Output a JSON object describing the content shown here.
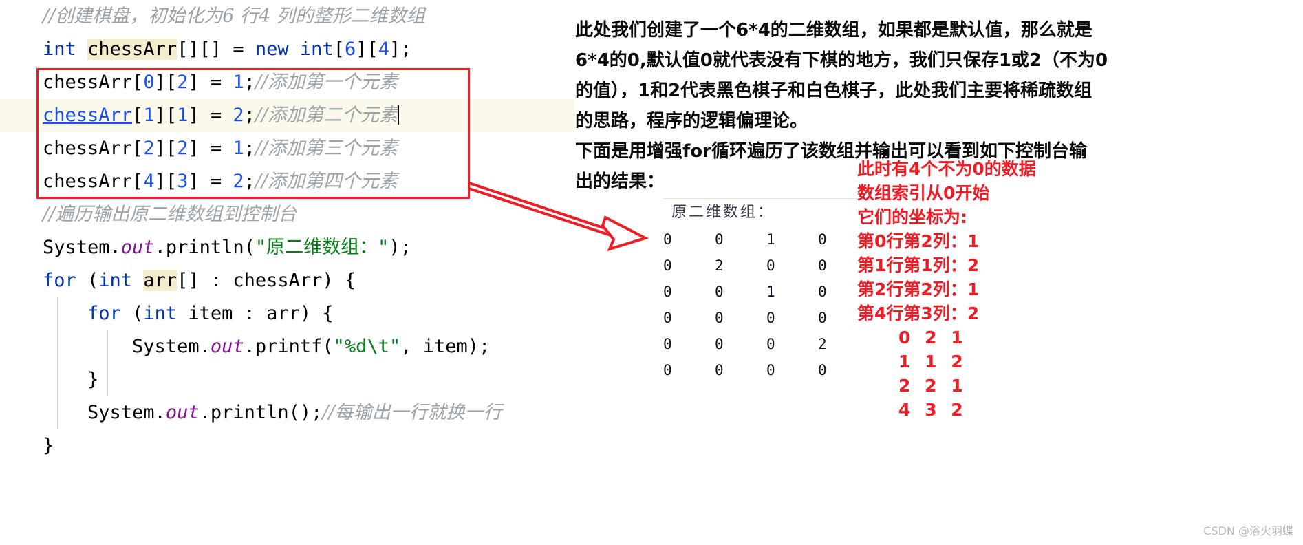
{
  "code": {
    "lines": [
      {
        "id": "c0",
        "highlight": false,
        "parts": [
          {
            "t": "//创建棋盘，初始化为6 行4 列的整形二维数组",
            "c": "cmt"
          }
        ]
      },
      {
        "id": "c1",
        "highlight": false,
        "parts": [
          {
            "t": "int ",
            "c": "kw"
          },
          {
            "t": "chessArr",
            "c": "ident-hi"
          },
          {
            "t": "[][] = ",
            "c": ""
          },
          {
            "t": "new ",
            "c": "kw"
          },
          {
            "t": "int",
            "c": "kw"
          },
          {
            "t": "[",
            "c": ""
          },
          {
            "t": "6",
            "c": "num"
          },
          {
            "t": "][",
            "c": ""
          },
          {
            "t": "4",
            "c": "num"
          },
          {
            "t": "];",
            "c": ""
          }
        ]
      },
      {
        "id": "c2",
        "highlight": false,
        "parts": [
          {
            "t": "chessArr",
            "c": ""
          },
          {
            "t": "[",
            "c": ""
          },
          {
            "t": "0",
            "c": "num"
          },
          {
            "t": "][",
            "c": ""
          },
          {
            "t": "2",
            "c": "num"
          },
          {
            "t": "] = ",
            "c": ""
          },
          {
            "t": "1",
            "c": "num"
          },
          {
            "t": ";",
            "c": ""
          },
          {
            "t": "//添加第一个元素",
            "c": "cmt"
          }
        ]
      },
      {
        "id": "c3",
        "highlight": true,
        "parts": [
          {
            "t": "chessArr",
            "c": "ident-underline"
          },
          {
            "t": "[",
            "c": ""
          },
          {
            "t": "1",
            "c": "num"
          },
          {
            "t": "][",
            "c": ""
          },
          {
            "t": "1",
            "c": "num"
          },
          {
            "t": "] = ",
            "c": ""
          },
          {
            "t": "2",
            "c": "num"
          },
          {
            "t": ";",
            "c": ""
          },
          {
            "t": "//添加第二个元素",
            "c": "cmt"
          },
          {
            "t": "CARET",
            "c": "caret"
          }
        ]
      },
      {
        "id": "c4",
        "highlight": false,
        "parts": [
          {
            "t": "chessArr",
            "c": ""
          },
          {
            "t": "[",
            "c": ""
          },
          {
            "t": "2",
            "c": "num"
          },
          {
            "t": "][",
            "c": ""
          },
          {
            "t": "2",
            "c": "num"
          },
          {
            "t": "] = ",
            "c": ""
          },
          {
            "t": "1",
            "c": "num"
          },
          {
            "t": ";",
            "c": ""
          },
          {
            "t": "//添加第三个元素",
            "c": "cmt"
          }
        ]
      },
      {
        "id": "c5",
        "highlight": false,
        "parts": [
          {
            "t": "chessArr",
            "c": ""
          },
          {
            "t": "[",
            "c": ""
          },
          {
            "t": "4",
            "c": "num"
          },
          {
            "t": "][",
            "c": ""
          },
          {
            "t": "3",
            "c": "num"
          },
          {
            "t": "] = ",
            "c": ""
          },
          {
            "t": "2",
            "c": "num"
          },
          {
            "t": ";",
            "c": ""
          },
          {
            "t": "//添加第四个元素",
            "c": "cmt"
          }
        ]
      },
      {
        "id": "c6",
        "highlight": false,
        "parts": [
          {
            "t": "//遍历输出原二维数组到控制台",
            "c": "cmt"
          }
        ]
      },
      {
        "id": "c7",
        "highlight": false,
        "parts": [
          {
            "t": "System.",
            "c": ""
          },
          {
            "t": "out",
            "c": "field"
          },
          {
            "t": ".println(",
            "c": ""
          },
          {
            "t": "\"原二维数组：\"",
            "c": "str"
          },
          {
            "t": ");",
            "c": ""
          }
        ]
      },
      {
        "id": "c8",
        "highlight": false,
        "parts": [
          {
            "t": "for ",
            "c": "kw"
          },
          {
            "t": "(",
            "c": ""
          },
          {
            "t": "int ",
            "c": "kw"
          },
          {
            "t": "arr",
            "c": "ident-hi"
          },
          {
            "t": "[] : chessArr) {",
            "c": ""
          }
        ]
      },
      {
        "id": "c9",
        "highlight": false,
        "parts": [
          {
            "t": "    ",
            "c": ""
          },
          {
            "t": "for ",
            "c": "kw"
          },
          {
            "t": "(",
            "c": ""
          },
          {
            "t": "int ",
            "c": "kw"
          },
          {
            "t": "item : arr) {",
            "c": ""
          }
        ]
      },
      {
        "id": "c10",
        "highlight": false,
        "parts": [
          {
            "t": "        System.",
            "c": ""
          },
          {
            "t": "out",
            "c": "field"
          },
          {
            "t": ".printf(",
            "c": ""
          },
          {
            "t": "\"%d\\t\"",
            "c": "str"
          },
          {
            "t": ", item);",
            "c": ""
          }
        ]
      },
      {
        "id": "c11",
        "highlight": false,
        "parts": [
          {
            "t": "    }",
            "c": ""
          }
        ]
      },
      {
        "id": "c12",
        "highlight": false,
        "parts": [
          {
            "t": "    System.",
            "c": ""
          },
          {
            "t": "out",
            "c": "field"
          },
          {
            "t": ".println();",
            "c": ""
          },
          {
            "t": "//每输出一行就换一行",
            "c": "cmt"
          }
        ]
      },
      {
        "id": "c13",
        "highlight": false,
        "parts": [
          {
            "t": "}",
            "c": ""
          }
        ]
      }
    ]
  },
  "note": {
    "paragraph_lines": [
      "此处我们创建了一个6*4的二维数组，如果都是默认值，那么就是",
      "6*4的0,默认值0就代表没有下棋的地方，我们只保存1或2（不为0",
      "的值），1和2代表黑色棋子和白色棋子，此处我们主要将稀疏数组",
      "的思路，程序的逻辑偏理论。",
      "下面是用增强for循环遍历了该数组并输出可以看到如下控制台输",
      "出的结果："
    ]
  },
  "console": {
    "title": "原二维数组：",
    "matrix": [
      [
        "0",
        "0",
        "1",
        "0"
      ],
      [
        "0",
        "2",
        "0",
        "0"
      ],
      [
        "0",
        "0",
        "1",
        "0"
      ],
      [
        "0",
        "0",
        "0",
        "0"
      ],
      [
        "0",
        "0",
        "0",
        "2"
      ],
      [
        "0",
        "0",
        "0",
        "0"
      ]
    ]
  },
  "annotations": {
    "red_lines": [
      "此时有4个不为0的数据",
      "数组索引从0开始",
      "它们的坐标为:",
      "第0行第2列：1",
      "第1行第1列：2",
      "第2行第2列：1",
      "第4行第3列：2"
    ],
    "red_triples": [
      "0 2 1",
      "1 1 2",
      "2 2 1",
      "4 3 2"
    ]
  },
  "watermark": {
    "text": "CSDN @浴火羽蝶"
  },
  "colors": {
    "red_accent": "#ee1c25",
    "keyword_blue": "#0033b3",
    "number_blue": "#1750eb",
    "string_green": "#067d17",
    "comment_gray": "#9ca3a8",
    "field_purple": "#871094",
    "highlight_bg": "#f4eccd",
    "line_highlight_bg": "#fbf8ec"
  }
}
